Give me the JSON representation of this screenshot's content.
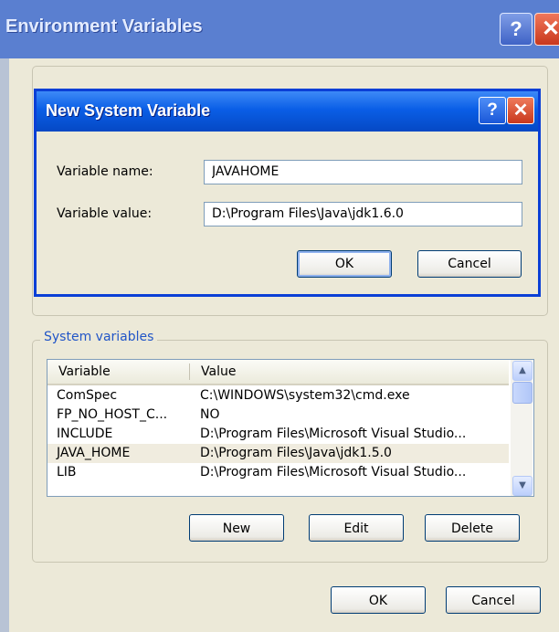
{
  "outer_window": {
    "title": "Environment Variables",
    "help_glyph": "?",
    "close_glyph": "✕"
  },
  "system_variables": {
    "group_label": "System variables",
    "columns": [
      "Variable",
      "Value"
    ],
    "rows": [
      {
        "variable": "ComSpec",
        "value": "C:\\WINDOWS\\system32\\cmd.exe"
      },
      {
        "variable": "FP_NO_HOST_C...",
        "value": "NO"
      },
      {
        "variable": "INCLUDE",
        "value": "D:\\Program Files\\Microsoft Visual Studio..."
      },
      {
        "variable": "JAVA_HOME",
        "value": "D:\\Program Files\\Java\\jdk1.5.0"
      },
      {
        "variable": "LIB",
        "value": "D:\\Program Files\\Microsoft Visual Studio..."
      }
    ],
    "selected_row": "JAVA_HOME",
    "buttons": {
      "new": "New",
      "edit": "Edit",
      "delete": "Delete"
    }
  },
  "footer": {
    "ok": "OK",
    "cancel": "Cancel"
  },
  "dialog": {
    "title": "New System Variable",
    "help_glyph": "?",
    "close_glyph": "✕",
    "name_label": "Variable name:",
    "name_value": "JAVAHOME",
    "value_label": "Variable value:",
    "value_value": "D:\\Program Files\\Java\\jdk1.6.0",
    "ok": "OK",
    "cancel": "Cancel"
  },
  "icons": {
    "scroll_up": "chevron-up-icon",
    "scroll_down": "chevron-down-icon"
  },
  "colors": {
    "dialog_title_bar": "#0a5ee6",
    "outer_title_bar": "#5a7fd0",
    "close_button": "#c8381d",
    "window_face": "#ece9d8",
    "group_label_text": "#2155c7"
  }
}
